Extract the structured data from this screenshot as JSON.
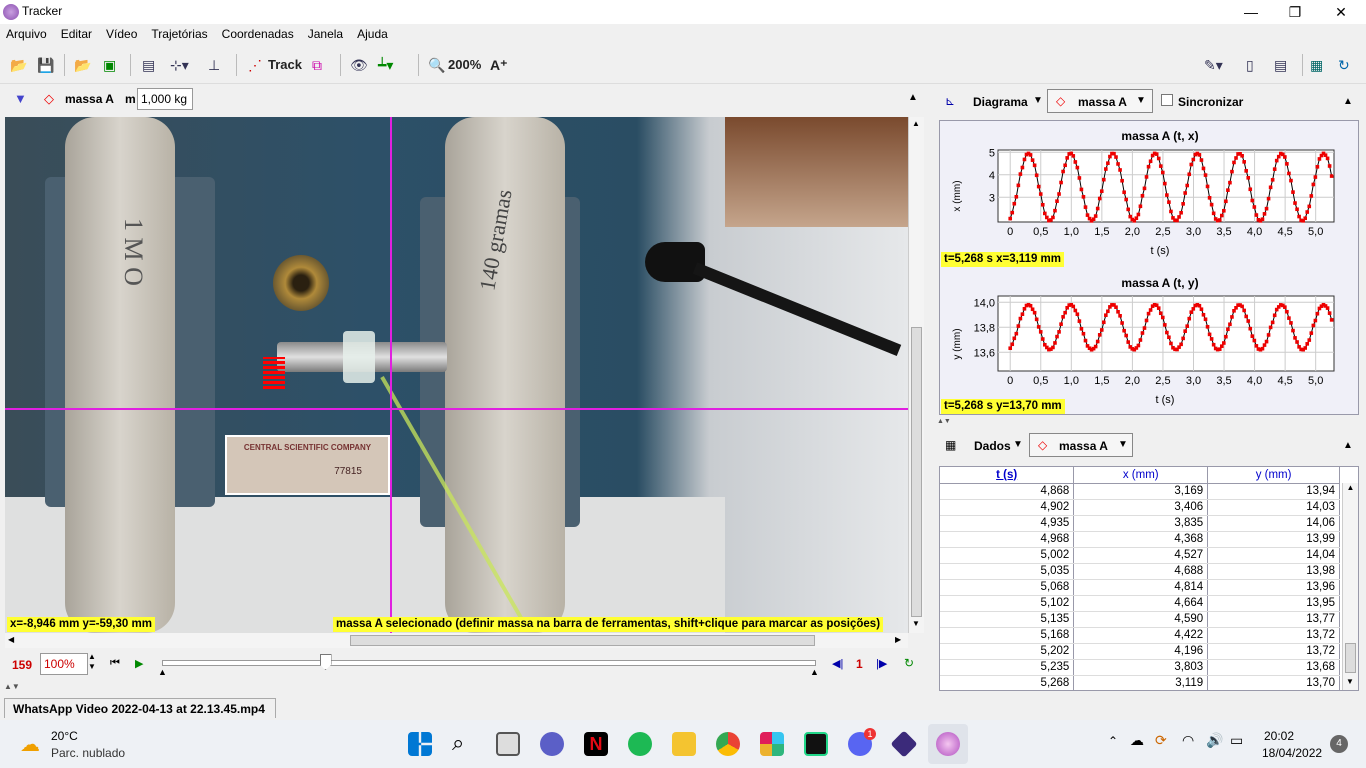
{
  "window": {
    "title": "Tracker",
    "minimize": "—",
    "maximize": "❐",
    "close": "✕"
  },
  "menu": [
    "Arquivo",
    "Editar",
    "Vídeo",
    "Trajetórias",
    "Coordenadas",
    "Janela",
    "Ajuda"
  ],
  "toolbar": {
    "track_label": "Track",
    "zoom_label": "200%",
    "font_label": "A⁺"
  },
  "trackbar": {
    "mass_name": "massa A",
    "mass_prefix": "m",
    "mass_value": "1,000 kg"
  },
  "video": {
    "coords_readout": "x=-8,946 mm  y=-59,30 mm",
    "status_message": "massa A selecionado (definir massa na barra de ferramentas, shift+clique para marcar as posições)",
    "label_left": "1 M O",
    "label_right": "140 gramas",
    "plate_title": "CENTRAL SCIENTIFIC COMPANY",
    "plate_number": "77815"
  },
  "player": {
    "frame": "159",
    "rate": "100%",
    "step": "1",
    "slider_position": 0.25
  },
  "diagram": {
    "menu_label": "Diagrama",
    "track": "massa A",
    "sync_label": "Sincronizar",
    "plot1": {
      "title": "massa A (t, x)",
      "ylabel": "x (mm)",
      "xlabel": "t (s)",
      "yticks": [
        "5",
        "4",
        "3"
      ],
      "xticks": [
        "0",
        "0,5",
        "1,0",
        "1,5",
        "2,0",
        "2,5",
        "3,0",
        "3,5",
        "4,0",
        "4,5",
        "5,0"
      ],
      "readout": "t=5,268 s  x=3,119 mm"
    },
    "plot2": {
      "title": "massa A (t, y)",
      "ylabel": "y (mm)",
      "xlabel": "t (s)",
      "yticks": [
        "14,0",
        "13,8",
        "13,6"
      ],
      "xticks": [
        "0",
        "0,5",
        "1,0",
        "1,5",
        "2,0",
        "2,5",
        "3,0",
        "3,5",
        "4,0",
        "4,5",
        "5,0"
      ],
      "readout": "t=5,268 s  y=13,70 mm"
    }
  },
  "chart_data": [
    {
      "type": "scatter",
      "title": "massa A (t, x)",
      "xlabel": "t (s)",
      "ylabel": "x (mm)",
      "xlim": [
        -0.2,
        5.3
      ],
      "ylim": [
        1.9,
        5.1
      ],
      "period": 0.69,
      "amplitude": 1.5,
      "offset": 3.45
    },
    {
      "type": "scatter",
      "title": "massa A (t, y)",
      "xlabel": "t (s)",
      "ylabel": "y (mm)",
      "xlim": [
        -0.2,
        5.3
      ],
      "ylim": [
        13.45,
        14.05
      ],
      "period": 0.69,
      "amplitude": 0.18,
      "offset": 13.8
    }
  ],
  "datapanel": {
    "menu_label": "Dados",
    "track": "massa A",
    "headers": [
      "t (s)",
      "x (mm)",
      "y (mm)"
    ],
    "rows": [
      [
        "4,868",
        "3,169",
        "13,94"
      ],
      [
        "4,902",
        "3,406",
        "14,03"
      ],
      [
        "4,935",
        "3,835",
        "14,06"
      ],
      [
        "4,968",
        "4,368",
        "13,99"
      ],
      [
        "5,002",
        "4,527",
        "14,04"
      ],
      [
        "5,035",
        "4,688",
        "13,98"
      ],
      [
        "5,068",
        "4,814",
        "13,96"
      ],
      [
        "5,102",
        "4,664",
        "13,95"
      ],
      [
        "5,135",
        "4,590",
        "13,77"
      ],
      [
        "5,168",
        "4,422",
        "13,72"
      ],
      [
        "5,202",
        "4,196",
        "13,72"
      ],
      [
        "5,235",
        "3,803",
        "13,68"
      ],
      [
        "5,268",
        "3,119",
        "13,70"
      ]
    ]
  },
  "file_tab": "WhatsApp Video 2022-04-13 at 22.13.45.mp4",
  "taskbar": {
    "temp": "20°C",
    "weather": "Parc. nublado",
    "time": "20:02",
    "date": "18/04/2022",
    "notif_count": "4",
    "discord_badge": "1"
  }
}
